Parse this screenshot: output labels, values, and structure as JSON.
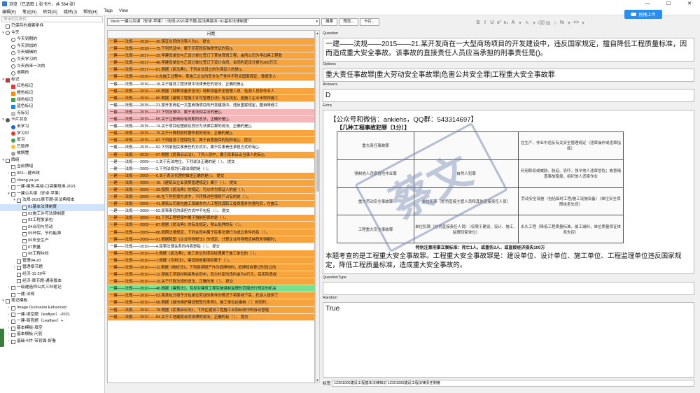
{
  "window": {
    "title": "浏览（已选取 1 张卡片，共 564 张）",
    "controls": [
      "—",
      "☐",
      "✕"
    ]
  },
  "menu": [
    "编辑(E)",
    "笔记(N)",
    "转到(G)",
    "跳转(J)",
    "帮助(H)",
    "Tags",
    "View"
  ],
  "upload_button": "拖拽上传",
  "sidebar": {
    "search_placeholder": "筛出栏目条件",
    "items": [
      {
        "label": "已保存的搜索条件",
        "icon": "filter",
        "indent": 0,
        "arrow": "",
        "color": ""
      },
      {
        "label": "今天",
        "icon": "clock",
        "indent": 0,
        "arrow": "▾",
        "color": ""
      },
      {
        "label": "今天到期的",
        "icon": "clock",
        "indent": 1,
        "arrow": "",
        "color": ""
      },
      {
        "label": "今天添加的",
        "icon": "clock",
        "indent": 1,
        "arrow": "",
        "color": ""
      },
      {
        "label": "今天编辑的",
        "icon": "clock",
        "indent": 1,
        "arrow": "",
        "color": ""
      },
      {
        "label": "今天学习的",
        "icon": "clock",
        "indent": 1,
        "arrow": "",
        "color": ""
      },
      {
        "label": "今天再来一次的",
        "icon": "clock",
        "indent": 1,
        "arrow": "",
        "color": ""
      },
      {
        "label": "逾期的",
        "icon": "clock",
        "indent": 1,
        "arrow": "",
        "color": ""
      },
      {
        "label": "标记",
        "icon": "flag",
        "indent": 0,
        "arrow": "▾",
        "color": "#b33a3a"
      },
      {
        "label": "红色标记",
        "icon": "flag",
        "indent": 1,
        "arrow": "",
        "color": "#e53935"
      },
      {
        "label": "橙色标记",
        "icon": "flag",
        "indent": 1,
        "arrow": "",
        "color": "#fb8c00"
      },
      {
        "label": "绿色标记",
        "icon": "flag",
        "indent": 1,
        "arrow": "",
        "color": "#43a047"
      },
      {
        "label": "蓝色标记",
        "icon": "flag",
        "indent": 1,
        "arrow": "",
        "color": "#1e88e5"
      },
      {
        "label": "无标记",
        "icon": "flag",
        "indent": 1,
        "arrow": "",
        "color": "#bdbdbd"
      },
      {
        "label": "卡片状态",
        "icon": "dot",
        "indent": 0,
        "arrow": "▾",
        "color": "#555555"
      },
      {
        "label": "未学习",
        "icon": "dot",
        "indent": 1,
        "arrow": "",
        "color": "#1e63d6"
      },
      {
        "label": "学习中",
        "icon": "dot",
        "indent": 1,
        "arrow": "",
        "color": "#e53935"
      },
      {
        "label": "复习",
        "icon": "dot",
        "indent": 1,
        "arrow": "",
        "color": "#43a047"
      },
      {
        "label": "已暂停",
        "icon": "dot",
        "indent": 1,
        "arrow": "",
        "color": "#f9c02b"
      },
      {
        "label": "被搁置",
        "icon": "dot",
        "indent": 1,
        "arrow": "",
        "color": "#9e9e9e"
      },
      {
        "label": "牌组",
        "icon": "deck",
        "indent": 0,
        "arrow": "▾",
        "color": ""
      },
      {
        "label": "当前牌组",
        "icon": "deck",
        "indent": 1,
        "arrow": "",
        "color": ""
      },
      {
        "label": "001—建市政",
        "icon": "deck",
        "indent": 1,
        "arrow": "›",
        "color": ""
      },
      {
        "label": "chong ya ya",
        "icon": "deck",
        "indent": 1,
        "arrow": "",
        "color": ""
      },
      {
        "label": "一建-建筑-高级-口袋建筑用-2021",
        "icon": "deck",
        "indent": 1,
        "arrow": "›",
        "color": ""
      },
      {
        "label": "一建公共课（安卓-苹果）",
        "icon": "deck",
        "indent": 1,
        "arrow": "▾",
        "color": ""
      },
      {
        "label": "法规-2021章节题-民法典版本",
        "icon": "deck",
        "indent": 2,
        "arrow": "▾",
        "color": ""
      },
      {
        "label": "01基本法律制度",
        "icon": "deck",
        "indent": 3,
        "arrow": "",
        "color": "",
        "selected": true
      },
      {
        "label": "02施工许可法律制度",
        "icon": "deck",
        "indent": 3,
        "arrow": "",
        "color": ""
      },
      {
        "label": "03工程发承包",
        "icon": "deck",
        "indent": 3,
        "arrow": "",
        "color": ""
      },
      {
        "label": "04合同与劳动",
        "icon": "deck",
        "indent": 3,
        "arrow": "",
        "color": ""
      },
      {
        "label": "05环保、节约能源",
        "icon": "deck",
        "indent": 3,
        "arrow": "",
        "color": ""
      },
      {
        "label": "06安全生产",
        "icon": "deck",
        "indent": 3,
        "arrow": "",
        "color": ""
      },
      {
        "label": "07质量",
        "icon": "deck",
        "indent": 3,
        "arrow": "",
        "color": ""
      },
      {
        "label": "08工程纠纷",
        "icon": "deck",
        "indent": 3,
        "arrow": "",
        "color": ""
      },
      {
        "label": "管理04-20",
        "icon": "deck",
        "indent": 2,
        "arrow": "",
        "color": ""
      },
      {
        "label": "管理章节题",
        "icon": "deck",
        "indent": 2,
        "arrow": "›",
        "color": ""
      },
      {
        "label": "经济-11-20年",
        "icon": "deck",
        "indent": 2,
        "arrow": "",
        "color": ""
      },
      {
        "label": "经济-章节题-通用版本",
        "icon": "deck",
        "indent": 2,
        "arrow": "",
        "color": ""
      },
      {
        "label": "一级建造师公共三科笔记",
        "icon": "deck",
        "indent": 1,
        "arrow": "›",
        "color": ""
      },
      {
        "label": "一建-法规",
        "icon": "deck",
        "indent": 1,
        "arrow": "",
        "color": ""
      },
      {
        "label": "笔记模板",
        "icon": "deck",
        "indent": 0,
        "arrow": "▾",
        "color": ""
      },
      {
        "label": "Image Occlusion Enhanced",
        "icon": "deck",
        "indent": 1,
        "arrow": "›",
        "color": ""
      },
      {
        "label": "一建-填空题（leaflyer）-2021",
        "icon": "deck",
        "indent": 1,
        "arrow": "›",
        "color": ""
      },
      {
        "label": "一建-简答题（Leaflyer）+",
        "icon": "deck",
        "indent": 1,
        "arrow": "›",
        "color": ""
      },
      {
        "label": "基本模板-填空",
        "icon": "deck",
        "indent": 1,
        "arrow": "›",
        "color": ""
      },
      {
        "label": "基本模板-问答",
        "icon": "deck",
        "indent": 1,
        "arrow": "›",
        "color": ""
      },
      {
        "label": "基础卡片-带背面-好看",
        "icon": "deck",
        "indent": 1,
        "arrow": "›",
        "color": ""
      }
    ]
  },
  "search": {
    "query": "\"deck:一建公共课（安卓-苹果）::法规-2021章节题-民法典版本::01基本法律制度\"",
    "buttons": [
      "搜索",
      "预览...",
      "卡片..."
    ]
  },
  "cardlist": {
    "header": "问题",
    "rows": [
      {
        "text": "一建——法规——2018——30.保证合同的当事人为()。        提交",
        "color": "o"
      },
      {
        "text": "一建——法规——2018——75.下列凭证中，属于印花税应纳税凭证的有()。",
        "color": "o"
      },
      {
        "text": "一建——法规——2017——39.甲建设单位与乙设计单位签订了某体育馆工程，由丙公司为甲出具工程款",
        "color": "o"
      },
      {
        "text": "一建——法规——2017——48.甲建设单位与乙设计单位签订了设计合同，合同约定设计费为200万元",
        "color": "o"
      },
      {
        "text": "一建——法规——2017——81.根据《民法典》，下列合法设立的为保证人的是()。",
        "color": "o"
      },
      {
        "text": "一建——法规——2016——5.在施工过程中，某施工企业的安全生产条件不符合国家规定，致使多人",
        "color": "o"
      },
      {
        "text": "一建——法规——2016——18.关于建设工程法律中法律责任的说法，正确的是()。",
        "color": "w"
      },
      {
        "text": "一建——法规——2016——68.根据《特种设备安全法》特种设备安全管理人员、检测人员和作业人",
        "color": "o"
      },
      {
        "text": "一建——法规——2016——80.根据《建筑工程施工许可管理办法》有关规定，因施工企业未取得施工",
        "color": "o"
      },
      {
        "text": "一建——法规——2015——21.某开发商在一大型商场项目的开发建设中，违反国家规定，擅自降低工",
        "color": "s"
      },
      {
        "text": "一建——法规——2015——37.下列法律中，属于宪法相关法的是()。",
        "color": "p"
      },
      {
        "text": "一建——法规——2015——55.关于注册商标有效期的说法，正确的是()。",
        "color": "p"
      },
      {
        "text": "一建——法规——2015——74.关于项目经理部及其行为法律后果的说法，正确的是()。",
        "color": "w"
      },
      {
        "text": "一建——法规——2015——76.关于计算机软件著作权的说法，正确的是()。",
        "color": "o"
      },
      {
        "text": "一建——法规——2015——83.下列建设工程保险中，属于自愿投保的险种有()。        提交",
        "color": "o"
      },
      {
        "text": "一建——法规——2015——92.下列承担民事责任的方式中，属于民事责任承担方式的有()。",
        "color": "w"
      },
      {
        "text": "一建——法规——2015——97.根据《民事诉讼法》，下列人员中，属于民事诉讼当事人的有()。",
        "color": "o"
      },
      {
        "text": "一建——法规——2009——1.关于宪法地位，下列说法正确的是（  ）。        提交",
        "color": "w"
      },
      {
        "text": "一建——法规——2009——3.下列法规为行政法规的是（   ）。",
        "color": "w"
      },
      {
        "text": "一建——法规——2009——6.关于表见代理的描述正确的是(     )。        提交",
        "color": "o"
      },
      {
        "text": "一建——法规——2009——16.《建筑业企业资质管理规定》属于（   ）。        提交",
        "color": "o"
      },
      {
        "text": "一建——法规——2009——39.按照《民法典》的规定，可以作为保证人的是（   ）。",
        "color": "o"
      },
      {
        "text": "一建——法规——2009——40.在下列担保方式中，不转移对担保财产占有的是（   ）。",
        "color": "o"
      },
      {
        "text": "一建——法规——2009——41.建筑公司承包施工某城市内人工程就其职工投保意外伤害险后，在施工",
        "color": "o"
      },
      {
        "text": "一建——法规——2009——52.民事责任的承担方式中不包括（   ）。        提交",
        "color": "w"
      },
      {
        "text": "一建——法规——2009——81.下列工程担保中属于强制担保的是（   ）。",
        "color": "o"
      },
      {
        "text": "一建——法规——2009——87.根据《民法典》的有关规定，禁止抵押的有（   ）。",
        "color": "o"
      },
      {
        "text": "一建——法规——2009——88.按照法律规定，下列合同中属于民事法律行为成立条件的有（   ）。",
        "color": "o"
      },
      {
        "text": "一建——法规——2009——91.根据我国《企业所得税法》的规定，计算企业所得税应纳税所得额时，",
        "color": "o"
      },
      {
        "text": "一建——法规——2010——4.民事法律关系的内容是指（   ）。        提交",
        "color": "w"
      },
      {
        "text": "一建——法规——2010——5.根据《民法典》，施工单位的项目经理属于施工单位的（   ）。",
        "color": "o"
      },
      {
        "text": "一建——法规——2010——7.根据《专利法》，建设用地使用权属于（   ）。",
        "color": "o"
      },
      {
        "text": "一建——法规——2010——11.根据《物权法》，下列各项财产作为抵押物时，抵押权自登记时设立的",
        "color": "o"
      },
      {
        "text": "一建——法规——2010——12.某施工项目材料采购合同中，双方约定的违约金为4万元，后实际造成",
        "color": "o"
      },
      {
        "text": "一建——法规——2010——19.关于行政法规的说法，正确的是（   ）。        提交",
        "color": "o"
      },
      {
        "text": "一建——法规——2010——46.根据《建筑法》，有权对建筑工程实施强制监理的范围进行规定的机关",
        "color": "g"
      },
      {
        "text": "一建——法规——2010——53.某承包方授予分包单位劳动的条件的情况下将某地下后，托运人提供了",
        "color": "o"
      },
      {
        "text": "一建——法规——2010——58.根据《城市维护建设税暂行条例》，施工单位在缴纳（   ）的同时，",
        "color": "o"
      },
      {
        "text": "一建——法规——2010——78.根据《民事诉讼法》，下列在建设工程施工合同纠纷中的诉讼管辖",
        "color": "o"
      },
      {
        "text": "一建——法规——2010——84.关于工地建筑合同法律的说法，正确的有（   ）。        提交",
        "color": "o"
      }
    ]
  },
  "editor": {
    "toolbar": [
      "B",
      "I",
      "U",
      "x²",
      "x₂",
      "A",
      "▾",
      "✎",
      "▾",
      "⌫",
      "▤",
      "☆",
      "fx",
      "▾",
      "<>",
      "▾"
    ],
    "question_label": "Question",
    "question": "一建——法规——2015——21.某开发商在一大型商场项目的开发建设中，违反国家规定，擅自降低工程质量标准，因而造成重大安全事故。该事故的直接责任人员应当承担的刑事责任是()。",
    "options_label": "Options",
    "options": "重大责任事故罪|重大劳动安全事故罪|危害公共安全罪|工程重大安全事故罪",
    "answers_label": "Answers",
    "answers": "D",
    "extra_label": "Extra",
    "extra_contact": "【公众号和微信：ankiehs，QQ群：543314697】",
    "extra_image": {
      "heading": "【几种工程事故犯罪（1分）】",
      "stamp": "蔡文",
      "rows": [
        {
          "name": "重大责任事故罪",
          "subject": "",
          "object": "在生产、作业中违反有关安全管理规定（违章操作或违章指挥）"
        },
        {
          "name": "强制他人违章冒险作业罪",
          "subject": "自然人犯罪",
          "object": "利用职权或威胁、胁迫、恐吓，强令他人违章冒险；故意掩盖事故隐患，组织他人违章作业"
        },
        {
          "name": "重大劳动安全事故罪",
          "subject": "单位犯罪（处罚直接主管人员和其他直接责任人员）",
          "object": "劳动安全设施（包括临时工程/施工设施设备）（单位安全保障体系失控）"
        },
        {
          "name": "工程重大安全事故罪",
          "subject": "单位犯罪（处罚直接责任人员）（仅限于建设、设计、施工、监理四家单位）",
          "object": "永久工程（降低工程质量标准，偷工减料，单位质量保证体系失控）"
        }
      ],
      "caption": "特别注意刑事立案标准：死亡1人，或重伤3人，或直接经济损失100万"
    },
    "extra_note": "本题考查的是工程重大安全事故罪。工程重大安全事故罪是：建设单位、设计单位、施工单位、工程监理单位违反国家规定，降低工程质量标准，造成重大安全事故的。",
    "questiontype_label": "QuestionType",
    "questiontype": "",
    "random_label": "Random",
    "random": "True",
    "tags_label": "标签",
    "tags": "1Z301000建设工程基本法律知识 1Z301000建设工程法律责任制度"
  }
}
